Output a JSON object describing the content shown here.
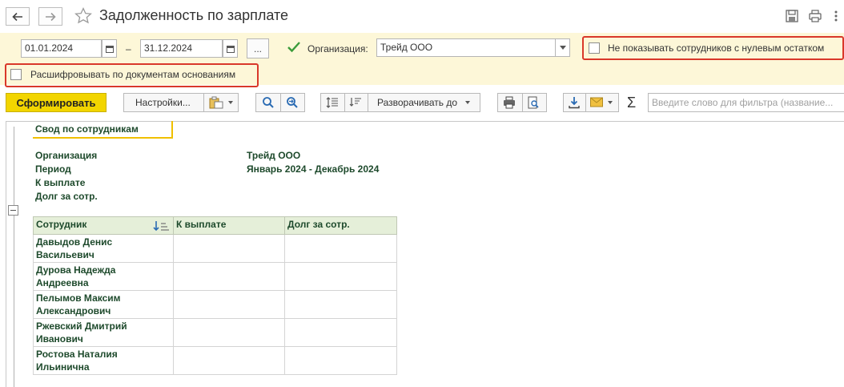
{
  "window": {
    "title": "Задолженность по зарплате"
  },
  "params": {
    "date_from": "01.01.2024",
    "date_sep": "–",
    "date_to": "31.12.2024",
    "more_btn": "...",
    "org_label": "Организация:",
    "org_value": "Трейд ООО",
    "org_checked": true,
    "hide_zero_label": "Не показывать сотрудников с нулевым остатком",
    "hide_zero_checked": false,
    "decode_label": "Расшифровывать по документам основаниям",
    "decode_checked": false
  },
  "toolbar": {
    "generate": "Сформировать",
    "settings": "Настройки...",
    "expand": "Разворачивать до",
    "sum_symbol": "Σ",
    "filter_placeholder": "Введите слово для фильтра (название..."
  },
  "report": {
    "header": "Свод по сотрудникам",
    "org_label": "Организация",
    "org_value": "Трейд ООО",
    "period_label": "Период",
    "period_value": "Январь 2024 - Декабрь 2024",
    "pay_label": "К выплате",
    "debt_label": "Долг за сотр.",
    "columns": [
      "Сотрудник",
      "К выплате",
      "Долг за сотр."
    ],
    "rows": [
      {
        "line1": "Давыдов Денис",
        "line2": "Васильевич",
        "pay": "",
        "debt": ""
      },
      {
        "line1": "Дурова Надежда",
        "line2": "Андреевна",
        "pay": "",
        "debt": ""
      },
      {
        "line1": "Пелымов Максим",
        "line2": "Александрович",
        "pay": "",
        "debt": ""
      },
      {
        "line1": "Ржевский Дмитрий",
        "line2": "Иванович",
        "pay": "",
        "debt": ""
      },
      {
        "line1": "Ростова Наталия",
        "line2": "Ильинична",
        "pay": "",
        "debt": ""
      }
    ]
  },
  "icons": {
    "back": "back-arrow-icon",
    "forward": "forward-arrow-icon",
    "favorite": "star-icon",
    "save": "save-icon",
    "print": "print-icon",
    "more": "more-vertical-icon",
    "calendar": "calendar-icon",
    "variants": "report-variants-icon",
    "search": "search-icon",
    "search_next": "search-next-icon",
    "expand_all": "expand-all-icon",
    "collapse_all": "collapse-all-icon",
    "print_report": "print-icon",
    "preview": "print-preview-icon",
    "export": "download-icon",
    "mail": "mail-icon",
    "sum": "sum-icon"
  },
  "colors": {
    "primary_button": "#f2d500",
    "panel_bg": "#fdf7d8",
    "highlight_frame": "#d9382a",
    "table_header_bg": "#e5efd9",
    "report_text": "#1e4a2c",
    "checkbox_green": "#3a9b3a"
  }
}
